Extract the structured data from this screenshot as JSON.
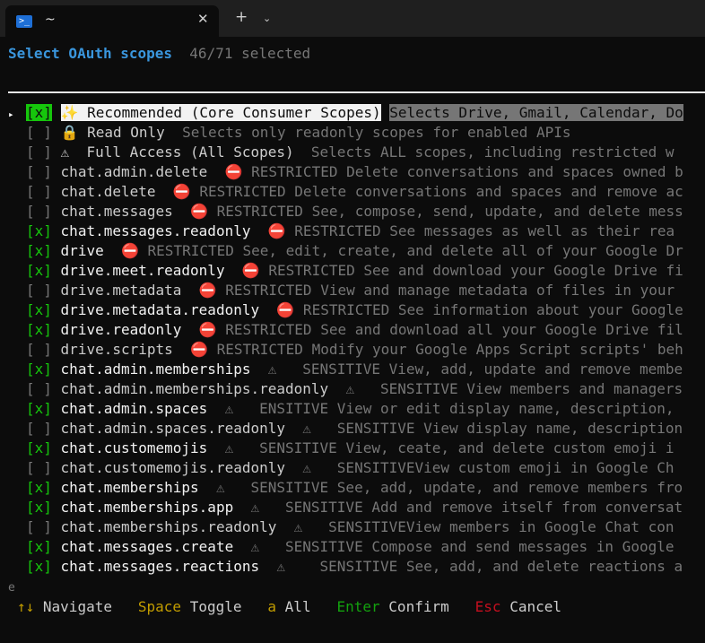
{
  "tab": {
    "title": "~",
    "icon": "terminal-icon",
    "close": "✕",
    "new_tab": "+",
    "dropdown": "⌄"
  },
  "header": {
    "title": "Select OAuth scopes",
    "count": "46/71 selected"
  },
  "pointer": "▸",
  "rows": [
    {
      "checked": "[x]",
      "name": "✨ Recommended (Core Consumer Scopes)",
      "desc": "Selects Drive, Gmail, Calendar, Do",
      "state": "on",
      "active": true
    },
    {
      "checked": "[ ]",
      "name": "🔒 Read Only",
      "desc": "Selects only readonly scopes for enabled APIs",
      "state": "off"
    },
    {
      "checked": "[ ]",
      "name": "⚠  Full Access (All Scopes)",
      "desc": "Selects ALL scopes, including restricted w",
      "state": "off"
    },
    {
      "checked": "[ ]",
      "name": "chat.admin.delete",
      "desc": "⛔ RESTRICTED Delete conversations and spaces owned b",
      "state": "off"
    },
    {
      "checked": "[ ]",
      "name": "chat.delete",
      "desc": "⛔ RESTRICTED Delete conversations and spaces and remove ac",
      "state": "off"
    },
    {
      "checked": "[ ]",
      "name": "chat.messages",
      "desc": "⛔ RESTRICTED See, compose, send, update, and delete mess",
      "state": "off"
    },
    {
      "checked": "[x]",
      "name": "chat.messages.readonly",
      "desc": "⛔ RESTRICTED See messages as well as their rea",
      "state": "on"
    },
    {
      "checked": "[x]",
      "name": "drive",
      "desc": "⛔ RESTRICTED See, edit, create, and delete all of your Google Dr",
      "state": "on"
    },
    {
      "checked": "[x]",
      "name": "drive.meet.readonly",
      "desc": "⛔ RESTRICTED See and download your Google Drive fi",
      "state": "on"
    },
    {
      "checked": "[ ]",
      "name": "drive.metadata",
      "desc": "⛔ RESTRICTED View and manage metadata of files in your",
      "state": "off"
    },
    {
      "checked": "[x]",
      "name": "drive.metadata.readonly",
      "desc": "⛔ RESTRICTED See information about your Google",
      "state": "on"
    },
    {
      "checked": "[x]",
      "name": "drive.readonly",
      "desc": "⛔ RESTRICTED See and download all your Google Drive fil",
      "state": "on"
    },
    {
      "checked": "[ ]",
      "name": "drive.scripts",
      "desc": "⛔ RESTRICTED Modify your Google Apps Script scripts' beh",
      "state": "off"
    },
    {
      "checked": "[x]",
      "name": "chat.admin.memberships",
      "desc": "⚠   SENSITIVE View, add, update and remove membe",
      "state": "on"
    },
    {
      "checked": "[ ]",
      "name": "chat.admin.memberships.readonly",
      "desc": "⚠   SENSITIVE View members and managers",
      "state": "off"
    },
    {
      "checked": "[x]",
      "name": "chat.admin.spaces",
      "desc": "⚠   ENSITIVE View or edit display name, description,",
      "state": "on"
    },
    {
      "checked": "[ ]",
      "name": "chat.admin.spaces.readonly",
      "desc": "⚠   SENSITIVE View display name, description",
      "state": "off"
    },
    {
      "checked": "[x]",
      "name": "chat.customemojis",
      "desc": "⚠   SENSITIVE View, ceate, and delete custom emoji i",
      "state": "on"
    },
    {
      "checked": "[ ]",
      "name": "chat.customemojis.readonly",
      "desc": "⚠   SENSITIVEView custom emoji in Google Ch",
      "state": "off"
    },
    {
      "checked": "[x]",
      "name": "chat.memberships",
      "desc": "⚠   SENSITIVE See, add, update, and remove members fro",
      "state": "on"
    },
    {
      "checked": "[x]",
      "name": "chat.memberships.app",
      "desc": "⚠   SENSITIVE Add and remove itself from conversat",
      "state": "on"
    },
    {
      "checked": "[ ]",
      "name": "chat.memberships.readonly",
      "desc": "⚠   SENSITIVEView members in Google Chat con",
      "state": "off"
    },
    {
      "checked": "[x]",
      "name": "chat.messages.create",
      "desc": "⚠   SENSITIVE Compose and send messages in Google",
      "state": "on"
    },
    {
      "checked": "[x]",
      "name": "chat.messages.reactions",
      "desc": "⚠    SENSITIVE See, add, and delete reactions a",
      "state": "on"
    }
  ],
  "stub": "e",
  "footer": {
    "nav_key": "↑↓",
    "nav_label": "Navigate",
    "space_key": "Space",
    "space_label": "Toggle",
    "a_key": "a",
    "a_label": "All",
    "enter_key": "Enter",
    "enter_label": "Confirm",
    "esc_key": "Esc",
    "esc_label": "Cancel"
  }
}
